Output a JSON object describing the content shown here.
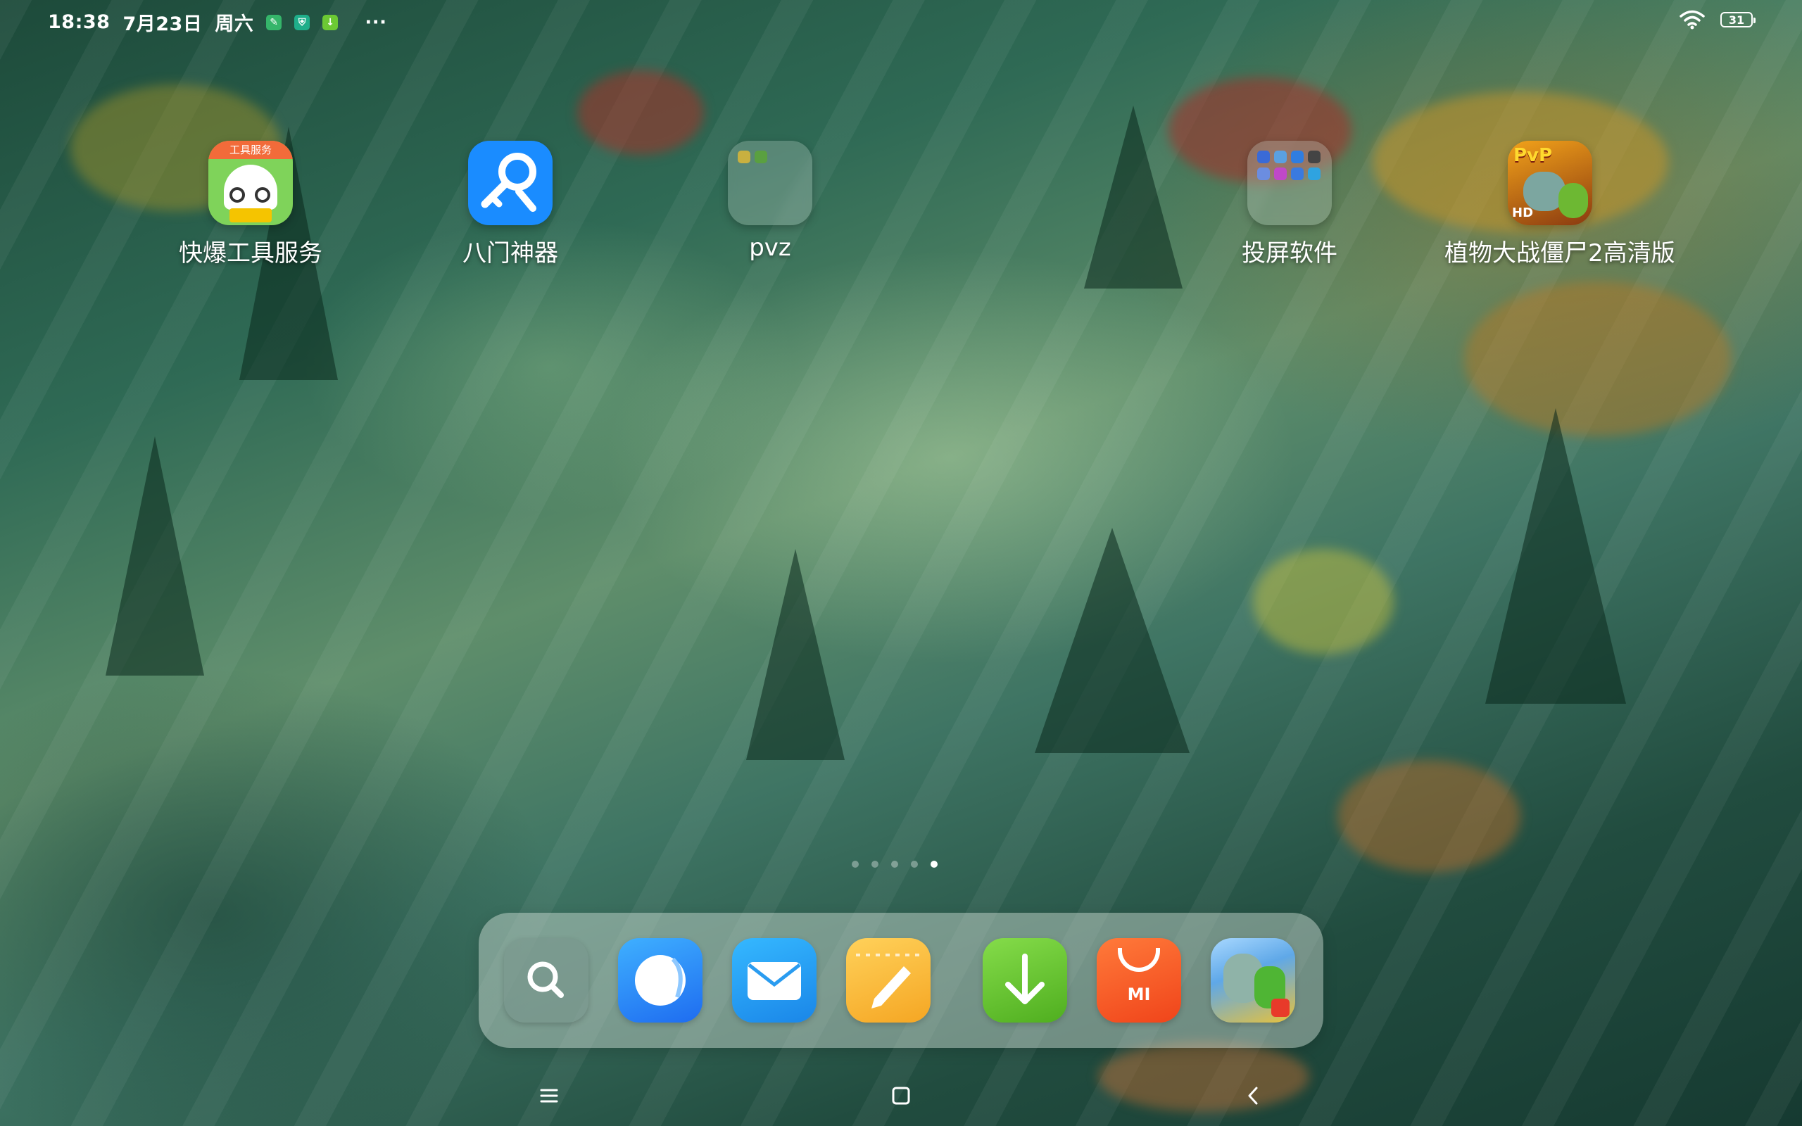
{
  "status_bar": {
    "time": "18:38",
    "date": "7月23日",
    "weekday": "周六",
    "more": "···",
    "battery": "31",
    "notification_icons": [
      "shield-app-icon",
      "security-icon",
      "download-icon"
    ]
  },
  "desktop": {
    "apps": [
      {
        "label": "快爆工具服务",
        "badge": "工具服务"
      },
      {
        "label": "八门神器"
      },
      {
        "label": "pvz"
      },
      {
        "label": "投屏软件"
      },
      {
        "label": "植物大战僵尸2高清版",
        "badge": "PvP",
        "sub_badge": "HD"
      }
    ]
  },
  "page_indicator": {
    "count": 5,
    "active": 5
  },
  "dock": {
    "apps": [
      {
        "name": "search",
        "icon": "search-icon"
      },
      {
        "name": "browser",
        "icon": "browser-icon"
      },
      {
        "name": "email",
        "icon": "mail-icon"
      },
      {
        "name": "notes",
        "icon": "notes-icon"
      },
      {
        "name": "downloads",
        "icon": "download-arrow-icon"
      },
      {
        "name": "mi-store",
        "icon": "mi-store-icon",
        "badge": "MI"
      },
      {
        "name": "pvz2",
        "icon": "game-icon"
      }
    ]
  },
  "colors": {
    "dock_search": "#6f8f86",
    "browser": "#1e90ff",
    "mail": "#1ea1f2",
    "notes": "#f7b733",
    "downloads": "#6cc934",
    "mi_store": "#ff5a1f"
  }
}
